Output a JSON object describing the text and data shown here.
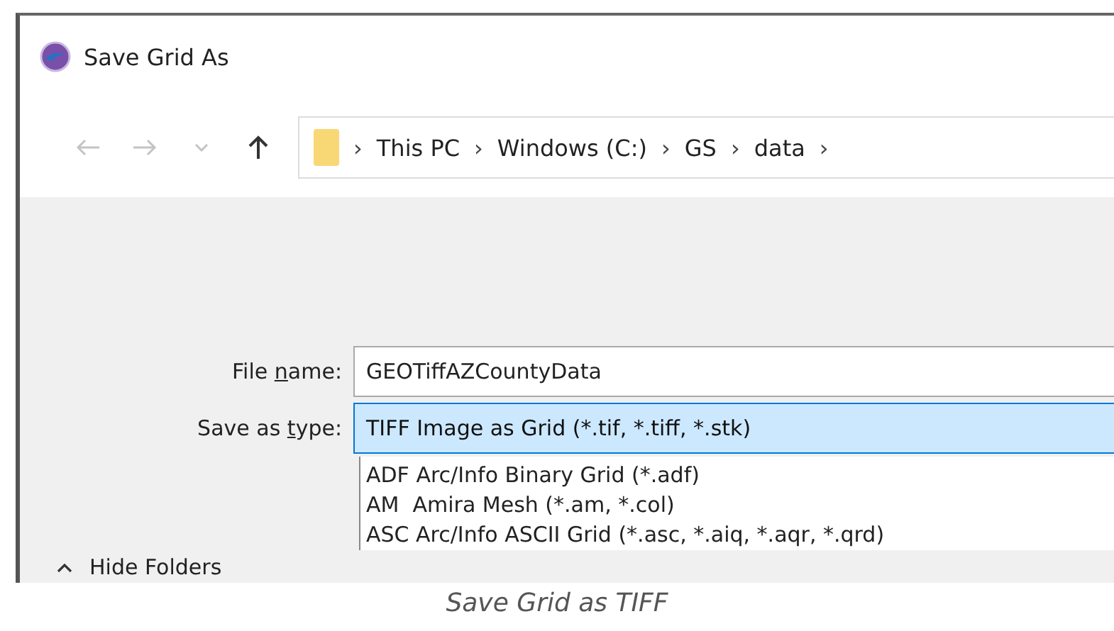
{
  "window": {
    "title": "Save Grid As"
  },
  "navigation": {
    "buttons": [
      {
        "kind": "back",
        "disabled": true
      },
      {
        "kind": "forward",
        "disabled": true
      },
      {
        "kind": "recent",
        "disabled": true
      },
      {
        "kind": "up",
        "disabled": false
      }
    ],
    "breadcrumbs": [
      {
        "label": "This PC"
      },
      {
        "label": "Windows (C:)"
      },
      {
        "label": "GS"
      },
      {
        "label": "data"
      }
    ],
    "separator": "›"
  },
  "file_name": {
    "label_start": "File ",
    "label_key": "n",
    "label_end": "ame:",
    "value": "GEOTiffAZCountyData"
  },
  "save_as_type": {
    "label_start": "Save as ",
    "label_key": "t",
    "label_end": "ype:",
    "value": "TIFF Image as Grid (*.tif, *.tiff, *.stk)",
    "expanded": true,
    "options": [
      {
        "label": "ADF Arc/Info Binary Grid (*.adf)",
        "selected": false
      },
      {
        "label": "AM  Amira Mesh (*.am, *.col)",
        "selected": false
      },
      {
        "label": "ASC Arc/Info ASCII Grid (*.asc, *.aiq, *.aqr, *.qrd)",
        "selected": false
      }
    ]
  },
  "hide_folders": {
    "label": "Hide Folders"
  },
  "caption": "Save Grid as TIFF"
}
